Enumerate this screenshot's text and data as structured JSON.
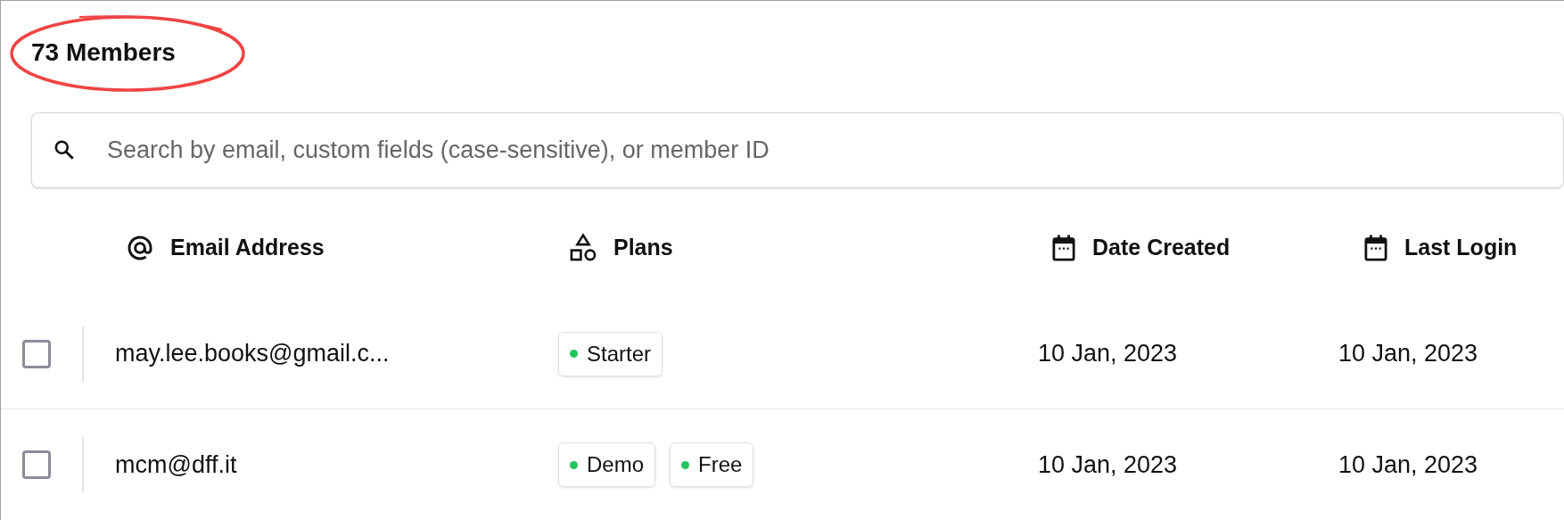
{
  "title": "73 Members",
  "search": {
    "placeholder": "Search by email, custom fields (case-sensitive), or member ID"
  },
  "columns": [
    {
      "label": "Email Address",
      "kind": "at"
    },
    {
      "label": "Plans",
      "kind": "shapes"
    },
    {
      "label": "Date Created",
      "kind": "calendar"
    },
    {
      "label": "Last Login",
      "kind": "calendar"
    }
  ],
  "rows": [
    {
      "checked": false,
      "email": "may.lee.books@gmail.c...",
      "plans": [
        "Starter"
      ],
      "date_created": "10 Jan, 2023",
      "last_login": "10 Jan, 2023"
    },
    {
      "checked": false,
      "email": "mcm@dff.it",
      "plans": [
        "Demo",
        "Free"
      ],
      "date_created": "10 Jan, 2023",
      "last_login": "10 Jan, 2023"
    }
  ]
}
